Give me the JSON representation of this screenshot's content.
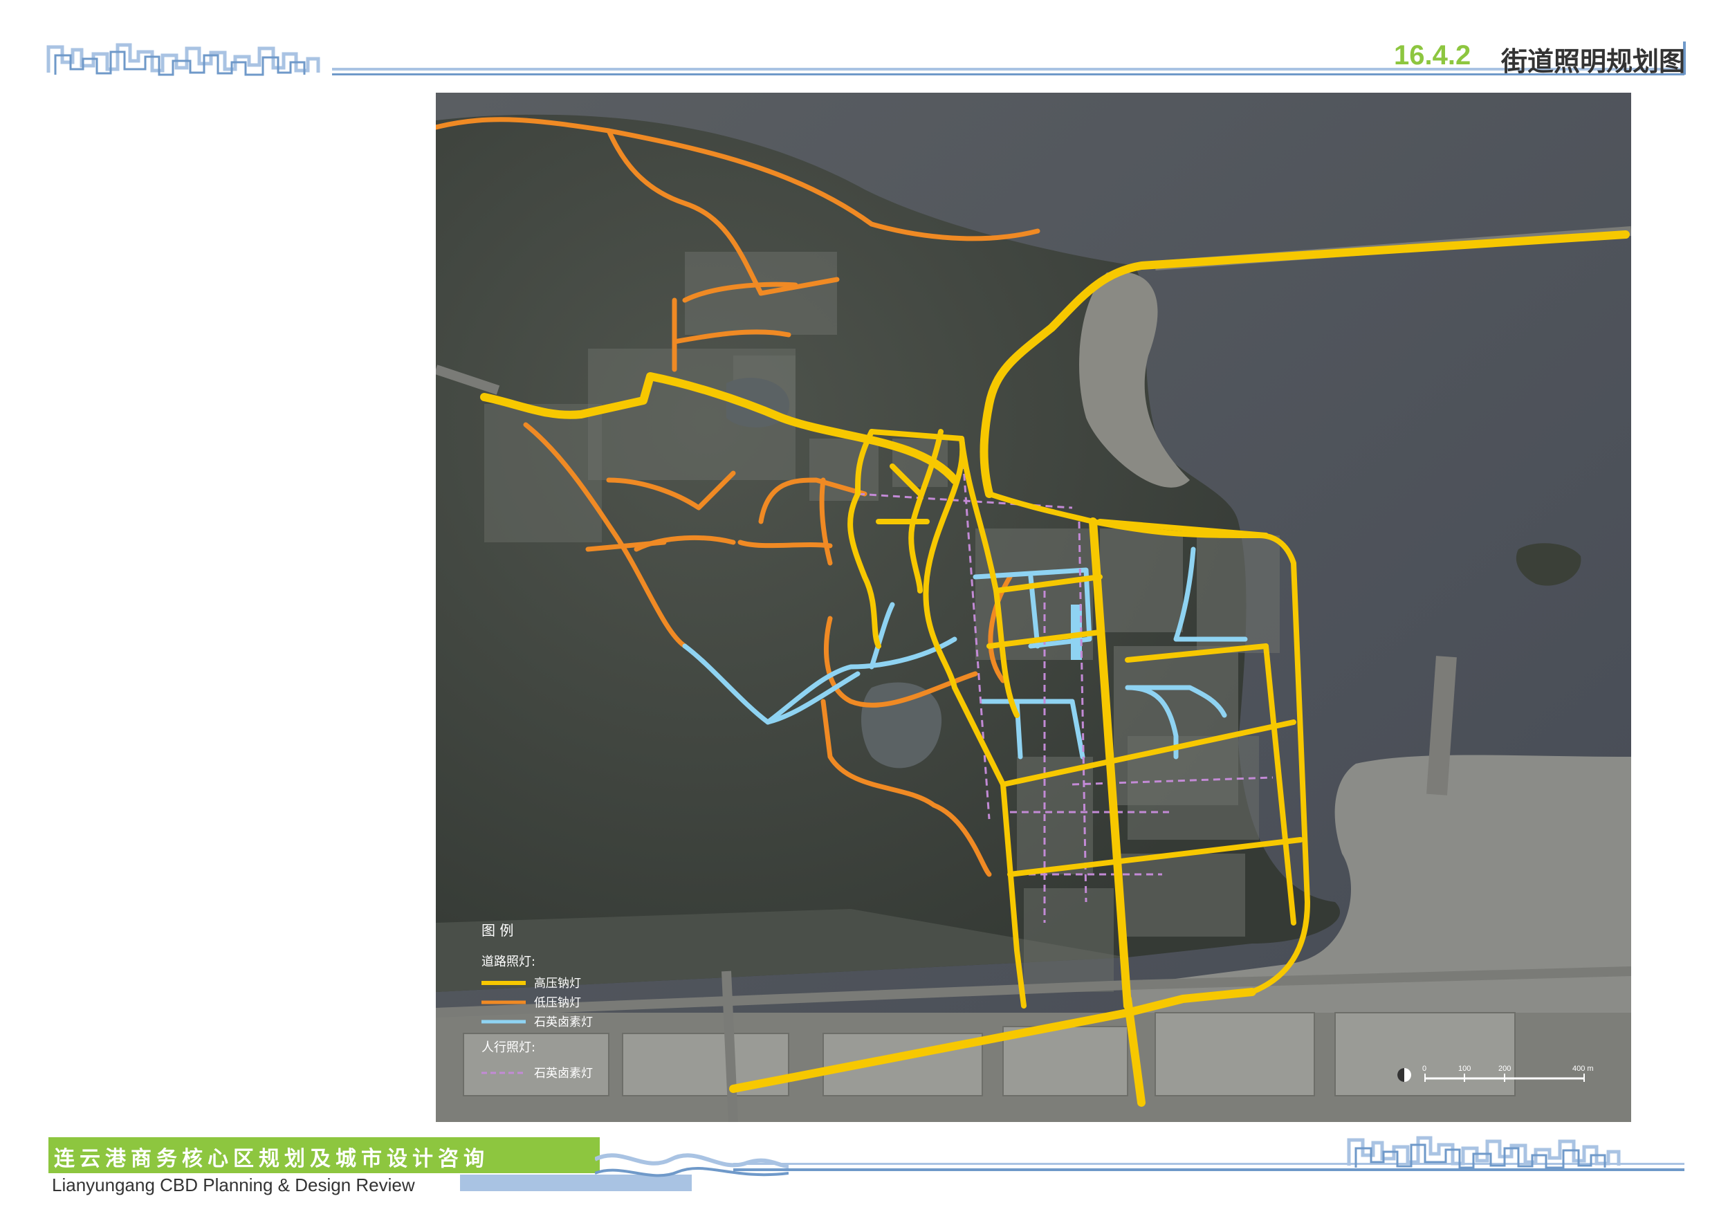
{
  "header": {
    "section_number": "16.4.2",
    "section_title": "街道照明规划图"
  },
  "map": {
    "legend": {
      "title": "图  例",
      "road_group_title": "道路照灯:",
      "pedestrian_group_title": "人行照灯:",
      "items": [
        {
          "label": "高压钠灯",
          "color": "#f7c800",
          "style": "solid-thick"
        },
        {
          "label": "低压钠灯",
          "color": "#f08a24",
          "style": "solid"
        },
        {
          "label": "石英卤素灯",
          "color": "#8fd3f2",
          "style": "solid"
        },
        {
          "label": "石英卤素灯",
          "color": "#c38ad6",
          "style": "dashed"
        }
      ]
    },
    "scale_bar": {
      "ticks": [
        "0",
        "100",
        "200",
        "400 m"
      ]
    },
    "colors": {
      "high_pressure_sodium": "#f7c800",
      "low_pressure_sodium": "#f08a24",
      "quartz_halogen": "#8fd3f2",
      "pedestrian": "#c38ad6",
      "sea": "#4a4f58",
      "land": "#3f453f",
      "beach": "#8f8f88"
    }
  },
  "footer": {
    "title_cn": "连云港商务核心区规划及城市设计咨询",
    "title_en": "Lianyungang CBD Planning & Design Review"
  }
}
